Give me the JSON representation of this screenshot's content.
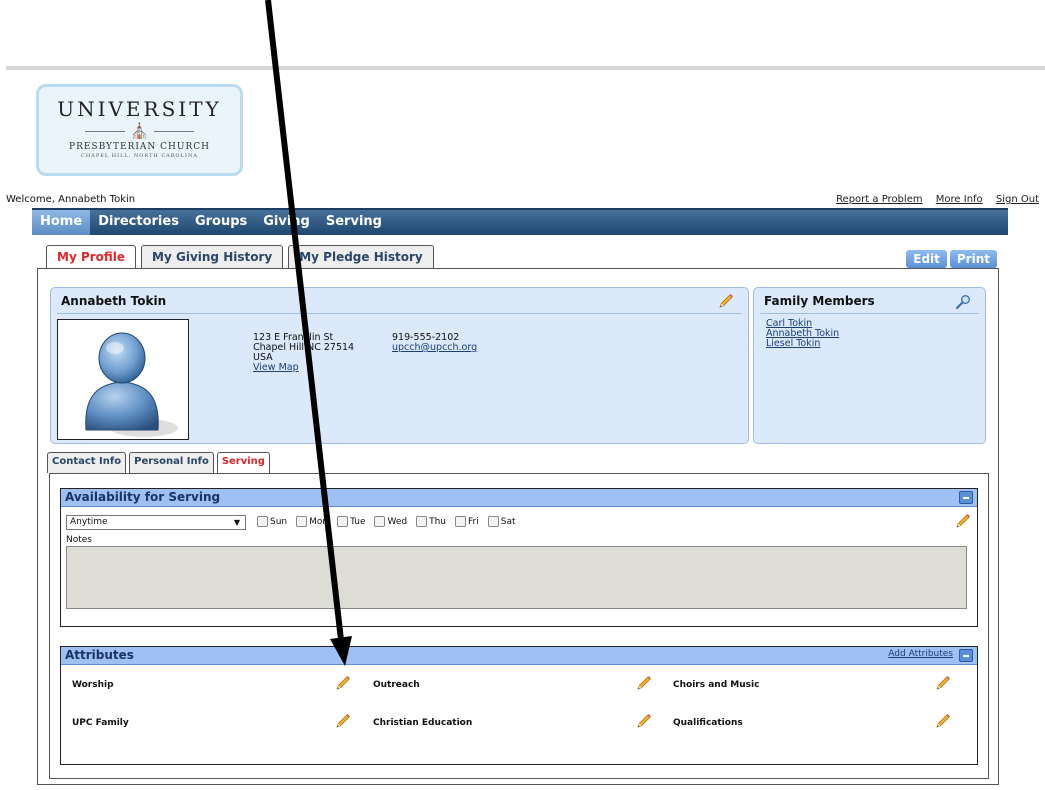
{
  "logo": {
    "main": "UNIVERSITY",
    "sub": "PRESBYTERIAN CHURCH",
    "sub2": "CHAPEL HILL, NORTH CAROLINA"
  },
  "header": {
    "welcome": "Welcome, Annabeth Tokin",
    "links": [
      "Report a Problem",
      "More Info",
      "Sign Out"
    ]
  },
  "nav": {
    "items": [
      "Home",
      "Directories",
      "Groups",
      "Giving",
      "Serving"
    ],
    "active": "Home"
  },
  "tabs": {
    "items": [
      "My Profile",
      "My Giving History",
      "My Pledge History"
    ],
    "active": "My Profile"
  },
  "actions": {
    "edit": "Edit",
    "print": "Print"
  },
  "profile": {
    "name": "Annabeth Tokin",
    "address_line1": "123 E Franklin St",
    "address_line2": "Chapel Hill NC 27514",
    "address_line3": "USA",
    "view_map": "View Map",
    "phone": "919-555-2102",
    "email": "upcch@upcch.org"
  },
  "family": {
    "title": "Family Members",
    "members": [
      "Carl Tokin",
      "Annabeth Tokin",
      "Liesel Tokin"
    ]
  },
  "subtabs": {
    "items": [
      "Contact Info",
      "Personal Info",
      "Serving"
    ],
    "active": "Serving"
  },
  "availability": {
    "title": "Availability for Serving",
    "selected": "Anytime",
    "days": [
      "Sun",
      "Mon",
      "Tue",
      "Wed",
      "Thu",
      "Fri",
      "Sat"
    ],
    "notes_label": "Notes",
    "notes_value": ""
  },
  "attributes": {
    "title": "Attributes",
    "add_label": "Add Attributes",
    "items": [
      "Worship",
      "Outreach",
      "Choirs and Music",
      "UPC Family",
      "Christian Education",
      "Qualifications"
    ]
  },
  "colors": {
    "nav_bg": "#2c5582",
    "active_tab": "#e0252b",
    "section_head": "#9ec0f3",
    "card_bg": "#dbe9fb"
  }
}
